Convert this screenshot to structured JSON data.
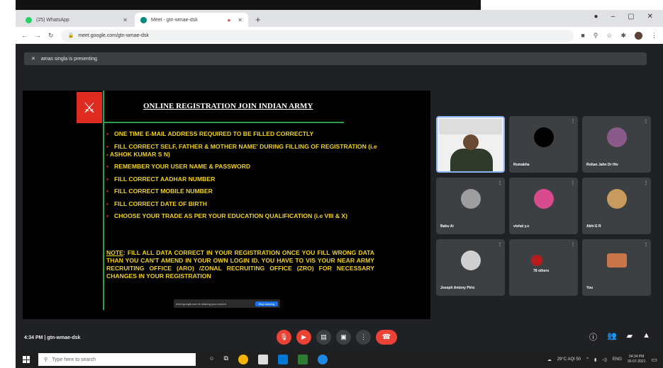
{
  "browser": {
    "tabs": [
      {
        "label": "(25) WhatsApp",
        "favicon_color": "#25d366",
        "active": false
      },
      {
        "label": "Meet - gtn-wmae-dsk",
        "favicon_color": "#00897b",
        "active": true
      }
    ],
    "new_tab": "+",
    "url": "meet.google.com/gtn-wmae-dsk"
  },
  "meet": {
    "presenting_banner": "amas singla is presenting",
    "meeting_time": "4:34 PM",
    "meeting_code": "gtn-wmae-dsk",
    "slide": {
      "title": "ONLINE REGISTRATION JOIN INDIAN ARMY",
      "bullets": [
        "ONE TIME E-MAIL ADDRESS REQUIRED TO BE FILLED CORRECTLY",
        "FILL CORRECT SELF, FATHER & MOTHER NAME' DURING FILLING OF REGISTRATION (i.e - ASHOK KUMAR S N)",
        "REMEMBER YOUR USER NAME & PASSWORD",
        "FILL CORRECT AADHAR NUMBER",
        "FILL CORRECT MOBILE NUMBER",
        "FILL CORRECT DATE OF BIRTH",
        "CHOOSE YOUR TRADE AS PER YOUR EDUCATION QUALIFICATION (i.e VIII & X)"
      ],
      "note_label": "NOTE",
      "note_text": ": FILL ALL DATA CORRECT IN YOUR REGISTRATION ONCE YOU FILL WRONG DATA THAN YOU CAN'T AMEND IN YOUR OWN LOGIN ID. YOU HAVE TO VIS YOUR NEAR ARMY RECRUITING OFFICE (ARO) /ZONAL RECRUITING OFFICE (ZRO) FOR NECESSARY CHANGES IN YOUR REGISTRATION",
      "share_bar_text": "meet.google.com is sharing your screen",
      "share_bar_stop": "Stop sharing"
    },
    "participants": [
      {
        "name": "",
        "presenter": true,
        "avatar_color": ""
      },
      {
        "name": "Rumakha",
        "presenter": false,
        "avatar_color": "#000000"
      },
      {
        "name": "Rohan Jahn Dr Hiv",
        "presenter": false,
        "avatar_color": "#8a5a8a"
      },
      {
        "name": "Babu Ai",
        "presenter": false,
        "avatar_color": "#9e9e9e"
      },
      {
        "name": "vishal y.s",
        "presenter": false,
        "avatar_color": "#d84b8c"
      },
      {
        "name": "Akhi E R",
        "presenter": false,
        "avatar_color": "#c79a5d"
      },
      {
        "name": "Joseph Antony Pirio",
        "presenter": false,
        "avatar_color": "#cfcfcf"
      },
      {
        "name": "78 others",
        "presenter": false,
        "avatar_color": "#b71c1c"
      },
      {
        "name": "You",
        "presenter": false,
        "avatar_color": "#c9764a"
      }
    ]
  },
  "taskbar": {
    "search_placeholder": "Type here to search",
    "weather": "29°C AQI 50",
    "lang": "ENG",
    "time": "04:34 PM",
    "date": "30-07-2021"
  }
}
